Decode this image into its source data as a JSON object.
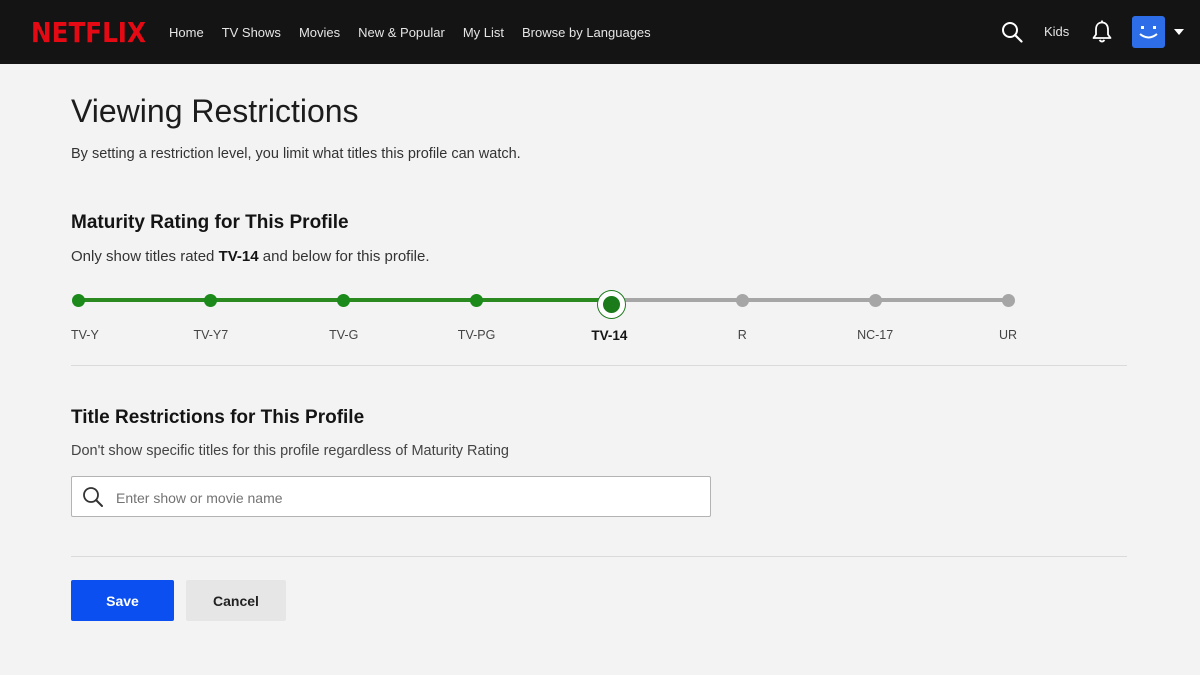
{
  "header": {
    "logo": "NETFLIX",
    "nav": [
      "Home",
      "TV Shows",
      "Movies",
      "New & Popular",
      "My List",
      "Browse by Languages"
    ],
    "kids_label": "Kids",
    "icons": [
      "search-icon",
      "bell-icon",
      "smiley-avatar",
      "caret-down-icon"
    ]
  },
  "page": {
    "title": "Viewing Restrictions",
    "description": "By setting a restriction level, you limit what titles this profile can watch."
  },
  "maturity": {
    "title": "Maturity Rating for This Profile",
    "desc_prefix": "Only show titles rated ",
    "selected_rating": "TV-14",
    "desc_suffix": " and below for this profile.",
    "ratings": [
      "TV-Y",
      "TV-Y7",
      "TV-G",
      "TV-PG",
      "TV-14",
      "R",
      "NC-17",
      "UR"
    ],
    "selected_index": 4
  },
  "title_restrictions": {
    "title": "Title Restrictions for This Profile",
    "description": "Don't show specific titles for this profile regardless of Maturity Rating",
    "search_placeholder": "Enter show or movie name"
  },
  "actions": {
    "save_label": "Save",
    "cancel_label": "Cancel"
  },
  "colors": {
    "brand": "#e50914",
    "accent_green": "#1b8a1a",
    "save_blue": "#0b4ff0",
    "header_bg": "#141414",
    "avatar_blue": "#2d6ee8"
  }
}
